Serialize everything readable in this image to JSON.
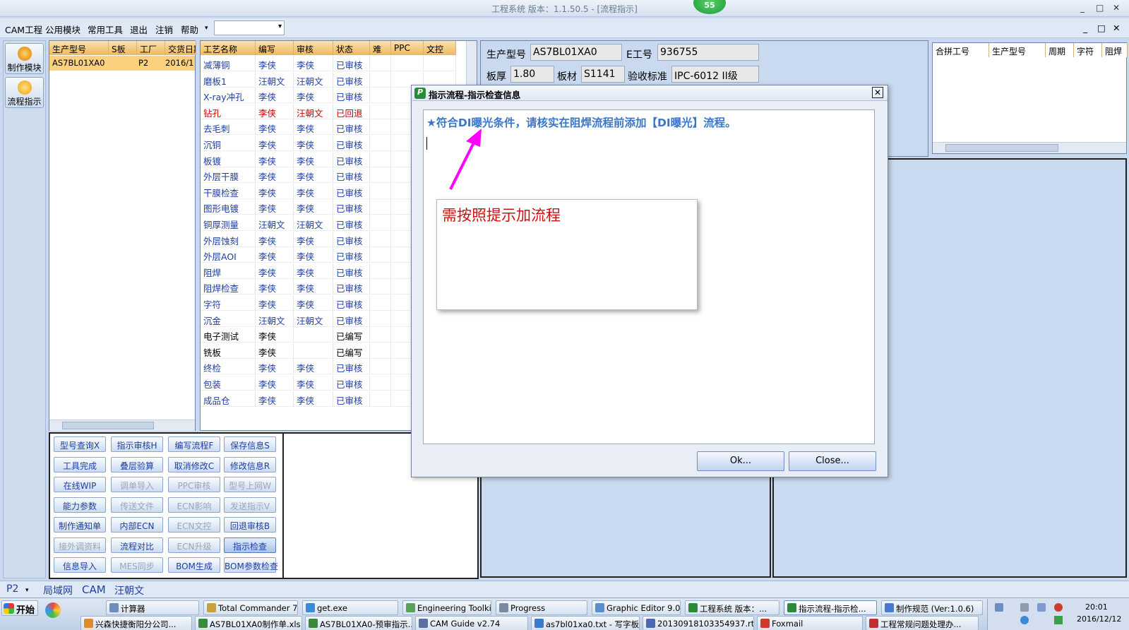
{
  "window": {
    "title": "工程系统   版本：1.1.50.5 - [流程指示]",
    "badge": "55",
    "controls": [
      "_",
      "□",
      "✕"
    ]
  },
  "menu": {
    "items": [
      "CAM工程",
      "公用模块",
      "常用工具",
      "退出",
      "注销",
      "帮助"
    ],
    "dropdown_arrow": "▾",
    "combo_value": "",
    "mdi_controls": [
      "_",
      "□",
      "✕"
    ]
  },
  "sidebar": {
    "items": [
      {
        "label": "制作模块",
        "icon": "fire-icon"
      },
      {
        "label": "流程指示",
        "icon": "flow-icon"
      }
    ]
  },
  "job_grid": {
    "columns": [
      "生产型号",
      "S板",
      "工厂",
      "交货日期"
    ],
    "rows": [
      [
        "AS7BL01XA0",
        "",
        "P2",
        "2016/1"
      ]
    ]
  },
  "process_grid": {
    "columns": [
      "工艺名称",
      "编写",
      "审核",
      "状态",
      "难",
      "PPC",
      "文控"
    ],
    "rows": [
      {
        "name": "减薄铜",
        "writer": "李侠",
        "reviewer": "李侠",
        "status": "已审核",
        "style": "blue"
      },
      {
        "name": "磨板1",
        "writer": "汪朝文",
        "reviewer": "汪朝文",
        "status": "已审核",
        "style": "blue"
      },
      {
        "name": "X-ray冲孔",
        "writer": "李侠",
        "reviewer": "李侠",
        "status": "已审核",
        "style": "blue"
      },
      {
        "name": "钻孔",
        "writer": "李侠",
        "reviewer": "汪朝文",
        "status": "已回退",
        "style": "red"
      },
      {
        "name": "去毛刺",
        "writer": "李侠",
        "reviewer": "李侠",
        "status": "已审核",
        "style": "blue"
      },
      {
        "name": "沉铜",
        "writer": "李侠",
        "reviewer": "李侠",
        "status": "已审核",
        "style": "blue"
      },
      {
        "name": "板镀",
        "writer": "李侠",
        "reviewer": "李侠",
        "status": "已审核",
        "style": "blue"
      },
      {
        "name": "外层干膜",
        "writer": "李侠",
        "reviewer": "李侠",
        "status": "已审核",
        "style": "blue"
      },
      {
        "name": "干膜检查",
        "writer": "李侠",
        "reviewer": "李侠",
        "status": "已审核",
        "style": "blue"
      },
      {
        "name": "图形电镀",
        "writer": "李侠",
        "reviewer": "李侠",
        "status": "已审核",
        "style": "blue"
      },
      {
        "name": "铜厚测量",
        "writer": "汪朝文",
        "reviewer": "汪朝文",
        "status": "已审核",
        "style": "blue"
      },
      {
        "name": "外层蚀刻",
        "writer": "李侠",
        "reviewer": "李侠",
        "status": "已审核",
        "style": "blue"
      },
      {
        "name": "外层AOI",
        "writer": "李侠",
        "reviewer": "李侠",
        "status": "已审核",
        "style": "blue"
      },
      {
        "name": "阻焊",
        "writer": "李侠",
        "reviewer": "李侠",
        "status": "已审核",
        "style": "blue"
      },
      {
        "name": "阻焊检查",
        "writer": "李侠",
        "reviewer": "李侠",
        "status": "已审核",
        "style": "blue"
      },
      {
        "name": "字符",
        "writer": "李侠",
        "reviewer": "李侠",
        "status": "已审核",
        "style": "blue"
      },
      {
        "name": "沉金",
        "writer": "汪朝文",
        "reviewer": "汪朝文",
        "status": "已审核",
        "style": "blue"
      },
      {
        "name": "电子测试",
        "writer": "李侠",
        "reviewer": "",
        "status": "已编写",
        "style": "blk"
      },
      {
        "name": "铣板",
        "writer": "李侠",
        "reviewer": "",
        "status": "已编写",
        "style": "blk"
      },
      {
        "name": "终检",
        "writer": "李侠",
        "reviewer": "李侠",
        "status": "已审核",
        "style": "blue"
      },
      {
        "name": "包装",
        "writer": "李侠",
        "reviewer": "李侠",
        "status": "已审核",
        "style": "blue"
      },
      {
        "name": "成品仓",
        "writer": "李侠",
        "reviewer": "李侠",
        "status": "已审核",
        "style": "blue"
      }
    ]
  },
  "function_buttons": [
    {
      "label": "型号查询X",
      "state": "enabled"
    },
    {
      "label": "指示审核H",
      "state": "enabled"
    },
    {
      "label": "编写流程F",
      "state": "enabled"
    },
    {
      "label": "保存信息S",
      "state": "enabled"
    },
    {
      "label": "工具完成",
      "state": "enabled"
    },
    {
      "label": "叠层验算",
      "state": "enabled"
    },
    {
      "label": "取消修改C",
      "state": "enabled"
    },
    {
      "label": "修改信息R",
      "state": "enabled"
    },
    {
      "label": "在线WIP",
      "state": "enabled"
    },
    {
      "label": "调单导入",
      "state": "disabled"
    },
    {
      "label": "PPC审核",
      "state": "disabled"
    },
    {
      "label": "型号上网W",
      "state": "disabled"
    },
    {
      "label": "能力参数",
      "state": "enabled"
    },
    {
      "label": "传送文件",
      "state": "disabled"
    },
    {
      "label": "ECN影响",
      "state": "disabled"
    },
    {
      "label": "发送指示V",
      "state": "disabled"
    },
    {
      "label": "制作通知单",
      "state": "enabled"
    },
    {
      "label": "内部ECN",
      "state": "enabled"
    },
    {
      "label": "ECN文控",
      "state": "disabled"
    },
    {
      "label": "回退审核B",
      "state": "enabled"
    },
    {
      "label": "接外调资料",
      "state": "disabled"
    },
    {
      "label": "流程对比",
      "state": "enabled"
    },
    {
      "label": "ECN升级",
      "state": "disabled"
    },
    {
      "label": "指示检查",
      "state": "selected"
    },
    {
      "label": "信息导入",
      "state": "enabled"
    },
    {
      "label": "MES同步",
      "state": "disabled"
    },
    {
      "label": "BOM生成",
      "state": "enabled"
    },
    {
      "label": "BOM参数检查",
      "state": "enabled"
    }
  ],
  "info": {
    "model_label": "生产型号",
    "model_value": "AS7BL01XA0",
    "eno_label": "E工号",
    "eno_value": "936755",
    "thickness_label": "板厚",
    "thickness_value": "1.80",
    "material_label": "板材",
    "material_value": "S1141",
    "standard_label": "验收标准",
    "standard_value": "IPC-6012 II级"
  },
  "merge_grid": {
    "columns": [
      "合拼工号",
      "生产型号",
      "周期",
      "字符",
      "阻焊"
    ]
  },
  "dialog": {
    "title": "指示流程-指示检查信息",
    "message": "★符合DI曝光条件，请核实在阻焊流程前添加【DI曝光】流程。",
    "ok_label": "Ok...",
    "close_label": "Close...",
    "close_icon": "✕"
  },
  "annotation": {
    "text": "需按照提示加流程",
    "arrow_color": "#ff00ff"
  },
  "statusbar": {
    "items": [
      "P2",
      "局域网",
      "CAM",
      "汪朝文"
    ]
  },
  "taskbar": {
    "start_label": "开始",
    "row1": [
      "计算器",
      "Total Commander 7...",
      "get.exe",
      "Engineering Toolkit ...",
      "Progress",
      "Graphic Editor 9.07...",
      "工程系统   版本：...",
      "指示流程-指示检...",
      "制作规范 (Ver:1.0.6)"
    ],
    "row2": [
      "兴森快捷衡阳分公司...",
      "AS7BL01XA0制作单.xls ...",
      "AS7BL01XA0-预审指示...",
      "CAM Guide v2.74",
      "as7bl01xa0.txt - 写字板",
      "201309181033549​37.rt...",
      "Foxmail",
      "工程常规问题处理办..."
    ],
    "clock_time": "20:01",
    "clock_date": "2016/12/12"
  }
}
